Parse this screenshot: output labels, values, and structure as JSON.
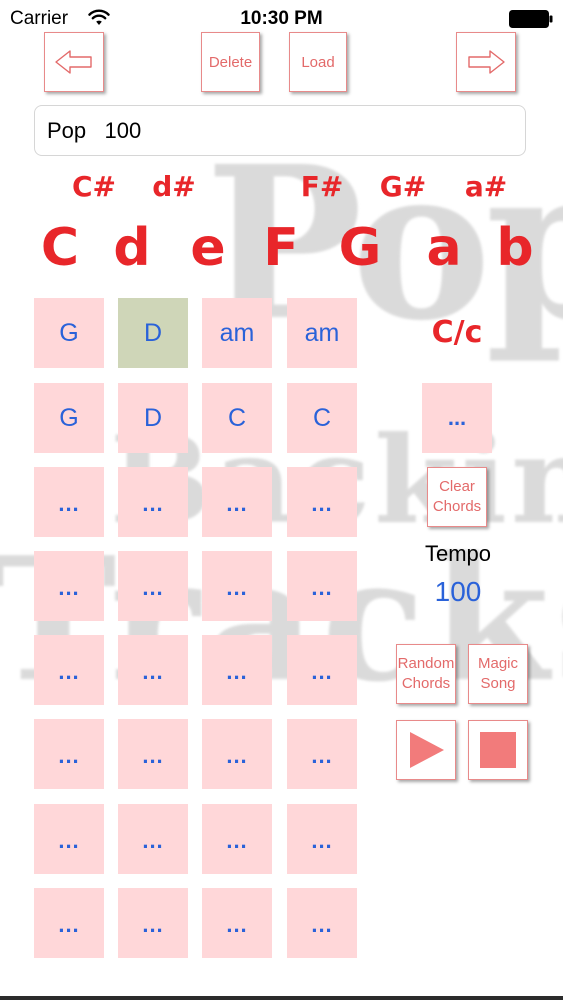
{
  "status_bar": {
    "carrier": "Carrier",
    "time": "10:30 PM"
  },
  "toolbar": {
    "prev_icon": "left-arrow-icon",
    "delete_label": "Delete",
    "load_label": "Load",
    "next_icon": "right-arrow-icon"
  },
  "song": {
    "value": "Pop   100"
  },
  "keys": {
    "sharps": [
      "C#",
      "d#",
      "F#",
      "G#",
      "a#"
    ],
    "naturals": [
      "C",
      "d",
      "e",
      "F",
      "G",
      "a",
      "b"
    ]
  },
  "grid": {
    "rows": [
      [
        "G",
        "D",
        "am",
        "am"
      ],
      [
        "G",
        "D",
        "C",
        "C"
      ],
      [
        "...",
        "...",
        "...",
        "..."
      ],
      [
        "...",
        "...",
        "...",
        "..."
      ],
      [
        "...",
        "...",
        "...",
        "..."
      ],
      [
        "...",
        "...",
        "...",
        "..."
      ],
      [
        "...",
        "...",
        "...",
        "..."
      ],
      [
        "...",
        "...",
        "...",
        "..."
      ]
    ],
    "selected": "D"
  },
  "side": {
    "current_chord": "C/c",
    "chord_slot": "...",
    "clear_label_line1": "Clear",
    "clear_label_line2": "Chords",
    "tempo_label": "Tempo",
    "tempo_value": "100",
    "random_label_line1": "Random",
    "random_label_line2": "Chords",
    "magic_label_line1": "Magic",
    "magic_label_line2": "Song",
    "play_icon": "play-icon",
    "stop_icon": "stop-icon"
  },
  "watermark": {
    "line1": "Pop",
    "line2": "Backing",
    "line3": "Tracks"
  },
  "colors": {
    "accent_red": "#e8262a",
    "button_text": "#e36a6a",
    "cell_pink": "#ffd7d9",
    "cell_selected": "#cfd6b8",
    "chord_blue": "#2a62d9"
  }
}
